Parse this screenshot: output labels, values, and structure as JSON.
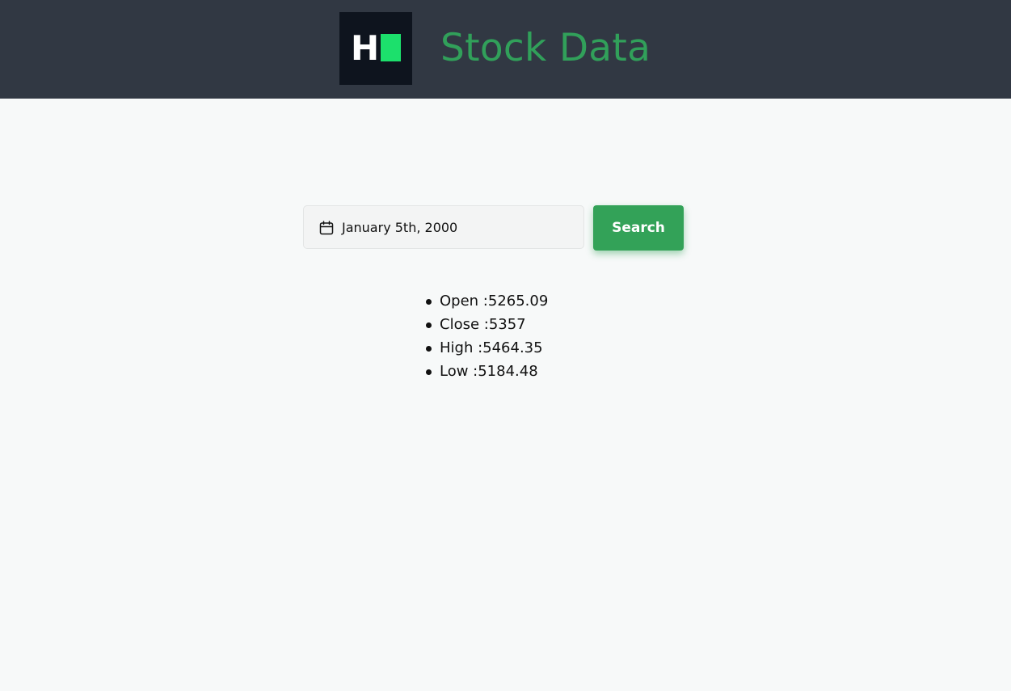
{
  "header": {
    "logo_letter": "H",
    "title": "Stock Data"
  },
  "search": {
    "date_value": "January 5th, 2000",
    "button_label": "Search"
  },
  "results": [
    {
      "label": "Open :",
      "value": "5265.09"
    },
    {
      "label": "Close :",
      "value": "5357"
    },
    {
      "label": "High :",
      "value": "5464.35"
    },
    {
      "label": "Low :",
      "value": "5184.48"
    }
  ],
  "colors": {
    "header_bg": "#313843",
    "accent": "#33a258",
    "logo_bg": "#0e141e",
    "logo_block": "#1ce06c"
  },
  "icons": {
    "date_field": "calendar-icon"
  }
}
